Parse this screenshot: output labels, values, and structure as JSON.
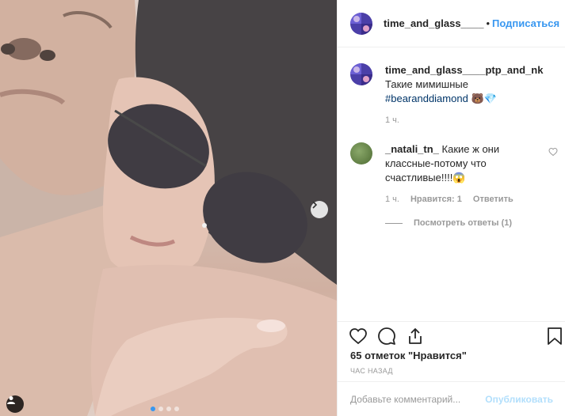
{
  "header": {
    "username": "time_and_glass____",
    "separator": "•",
    "follow_label": "Подписаться"
  },
  "caption": {
    "username": "time_and_glass____ptp_and_nk",
    "text": "Такие мимишные",
    "hashtag": "#bearanddiamond",
    "emoji": "🐻💎",
    "time": "1 ч."
  },
  "comment": {
    "username": "_natali_tn_",
    "text": "Какие ж они классные-потому что счастливые!!!!😱",
    "time": "1 ч.",
    "likes": "Нравится: 1",
    "reply_label": "Ответить",
    "view_replies": "Посмотреть ответы (1)"
  },
  "post": {
    "likes_text": "65 отметок \"Нравится\"",
    "time_ago": "ЧАС НАЗАД"
  },
  "add_comment": {
    "placeholder": "Добавьте комментарий...",
    "publish_label": "Опубликовать"
  },
  "carousel": {
    "slides": 4,
    "active_index": 0
  },
  "colors": {
    "accent": "#3897f0",
    "text": "#262626",
    "muted": "#999999",
    "publish_disabled": "#b2dffc"
  },
  "icons": [
    "chevron-right-icon",
    "user-tag-icon",
    "heart-icon",
    "comment-icon",
    "share-icon",
    "bookmark-icon"
  ]
}
